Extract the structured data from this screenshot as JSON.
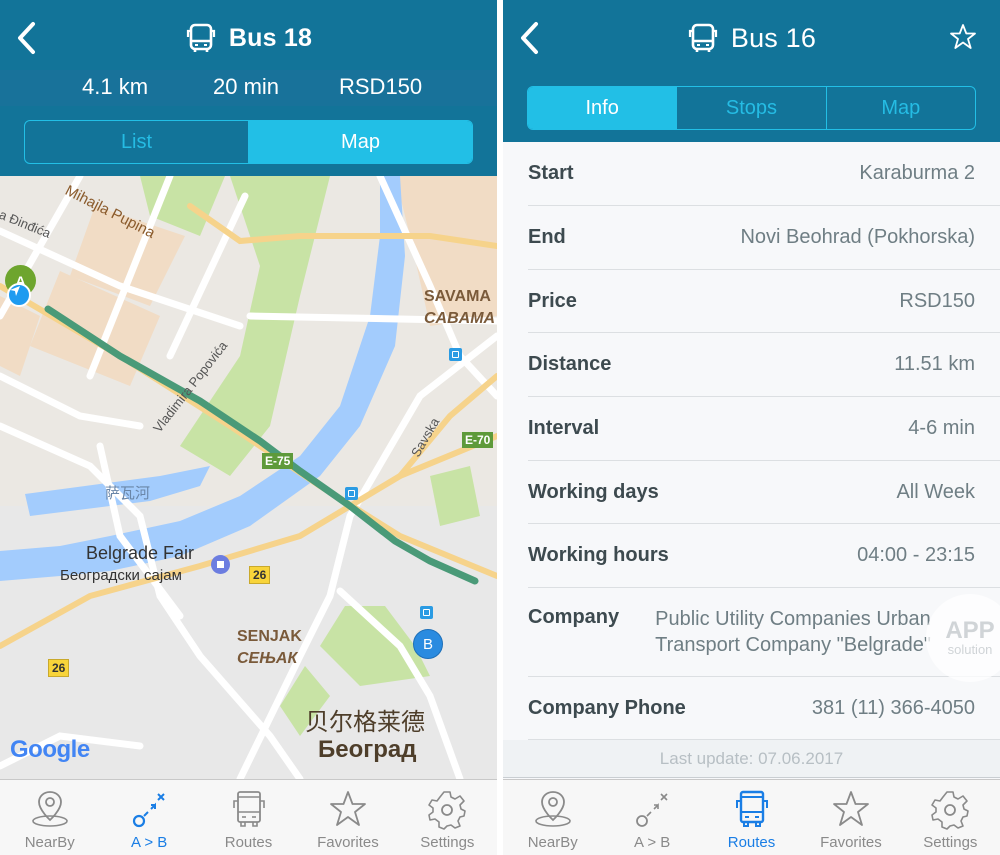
{
  "left_screen": {
    "header": {
      "title": "Bus 18",
      "back_icon": "chevron-left-icon",
      "title_icon": "bus-icon"
    },
    "summary": {
      "distance": "4.1 km",
      "duration": "20 min",
      "price": "RSD150"
    },
    "segments": [
      {
        "label": "List",
        "active": false
      },
      {
        "label": "Map",
        "active": true
      }
    ],
    "map": {
      "labels": {
        "street_mihajla_pupina": "Mihajla Pupina",
        "street_dindica": "na Đinđića",
        "street_popovica": "Vladimira Popovića",
        "street_savska": "Savska",
        "district_savamala_latin": "SAVAMA",
        "district_savamala_cyrillic": "CABAMA",
        "river_chinese": "萨瓦河",
        "poi_fair_en": "Belgrade Fair",
        "poi_fair_sr": "Београдски сајам",
        "district_senjak_latin": "SENJAK",
        "district_senjak_cyrillic": "СЕЊАК",
        "city_chinese": "贝尔格莱德",
        "city_cyrillic": "Београд",
        "attribution": "Google"
      },
      "shields": {
        "e75": "E-75",
        "e70": "E-70",
        "r26a": "26",
        "r26b": "26"
      },
      "markers": {
        "start": "A",
        "end": "B"
      },
      "colors": {
        "route": "#4a9a78",
        "water": "#a3ccfd",
        "park": "#c8e3a5",
        "pin_start": "#6ea52e",
        "pin_end": "#2a8be0",
        "location": "#1e9bf0"
      }
    },
    "tabbar": [
      {
        "label": "NearBy",
        "icon": "map-pin-icon",
        "active": false
      },
      {
        "label": "A > B",
        "icon": "route-a-to-b-icon",
        "active": true
      },
      {
        "label": "Routes",
        "icon": "bus-icon",
        "active": false
      },
      {
        "label": "Favorites",
        "icon": "star-icon",
        "active": false
      },
      {
        "label": "Settings",
        "icon": "gear-icon",
        "active": false
      }
    ]
  },
  "right_screen": {
    "header": {
      "title": "Bus 16",
      "back_icon": "chevron-left-icon",
      "title_icon": "bus-icon",
      "favorite_icon": "star-outline-icon"
    },
    "segments": [
      {
        "label": "Info",
        "active": true
      },
      {
        "label": "Stops",
        "active": false
      },
      {
        "label": "Map",
        "active": false
      }
    ],
    "info": [
      {
        "label": "Start",
        "value": "Karaburma 2"
      },
      {
        "label": "End",
        "value": "Novi Beohrad (Pokhorska)"
      },
      {
        "label": "Price",
        "value": "RSD150"
      },
      {
        "label": "Distance",
        "value": "11.51 km"
      },
      {
        "label": "Interval",
        "value": "4-6 min"
      },
      {
        "label": "Working days",
        "value": "All Week"
      },
      {
        "label": "Working hours",
        "value": "04:00 - 23:15"
      },
      {
        "label": "Company",
        "value": "Public Utility Companies Urban Transport Company \"Belgrade\""
      },
      {
        "label": "Company Phone",
        "value": "381 (11) 366-4050"
      }
    ],
    "last_update": "Last update: 07.06.2017",
    "watermark": {
      "big": "APP",
      "small": "solution"
    },
    "tabbar": [
      {
        "label": "NearBy",
        "icon": "map-pin-icon",
        "active": false
      },
      {
        "label": "A > B",
        "icon": "route-a-to-b-icon",
        "active": false
      },
      {
        "label": "Routes",
        "icon": "bus-icon",
        "active": true
      },
      {
        "label": "Favorites",
        "icon": "star-icon",
        "active": false
      },
      {
        "label": "Settings",
        "icon": "gear-icon",
        "active": false
      }
    ]
  },
  "theme": {
    "header_bg": "#127499",
    "accent": "#22bfe6",
    "tab_active": "#1a7ee5",
    "tab_inactive": "#8a8a8a"
  }
}
